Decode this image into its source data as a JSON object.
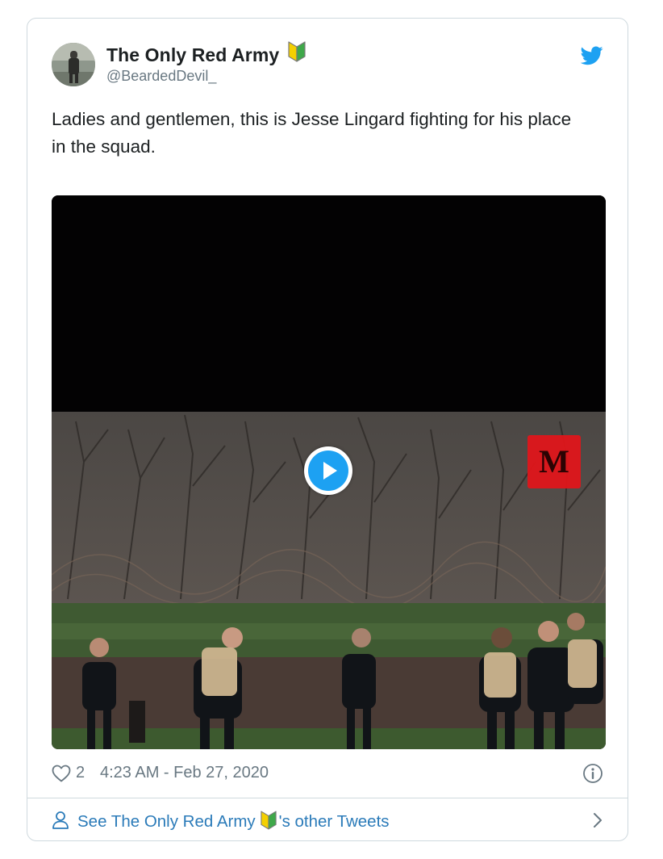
{
  "tweet": {
    "display_name": "The Only Red Army",
    "handle": "@BeardedDevil_",
    "text": "Ladies and gentlemen, this is Jesse Lingard fighting for his place in the squad.",
    "media_watermark": "M",
    "likes": "2",
    "timestamp": "4:23 AM - Feb 27, 2020"
  },
  "footer": {
    "other_tweets_prefix": "See The Only Red Army",
    "other_tweets_suffix": "'s other Tweets"
  },
  "icons": {
    "badge": "beginner-badge-icon",
    "brand": "twitter-bird-icon",
    "like": "heart-icon",
    "info": "info-icon",
    "person": "person-icon",
    "chevron": "chevron-right-icon",
    "play": "play-icon"
  },
  "colors": {
    "accent": "#1da1f2",
    "link": "#2b7bb9",
    "muted": "#697882",
    "text": "#1c2022",
    "border": "#cfd9de"
  }
}
